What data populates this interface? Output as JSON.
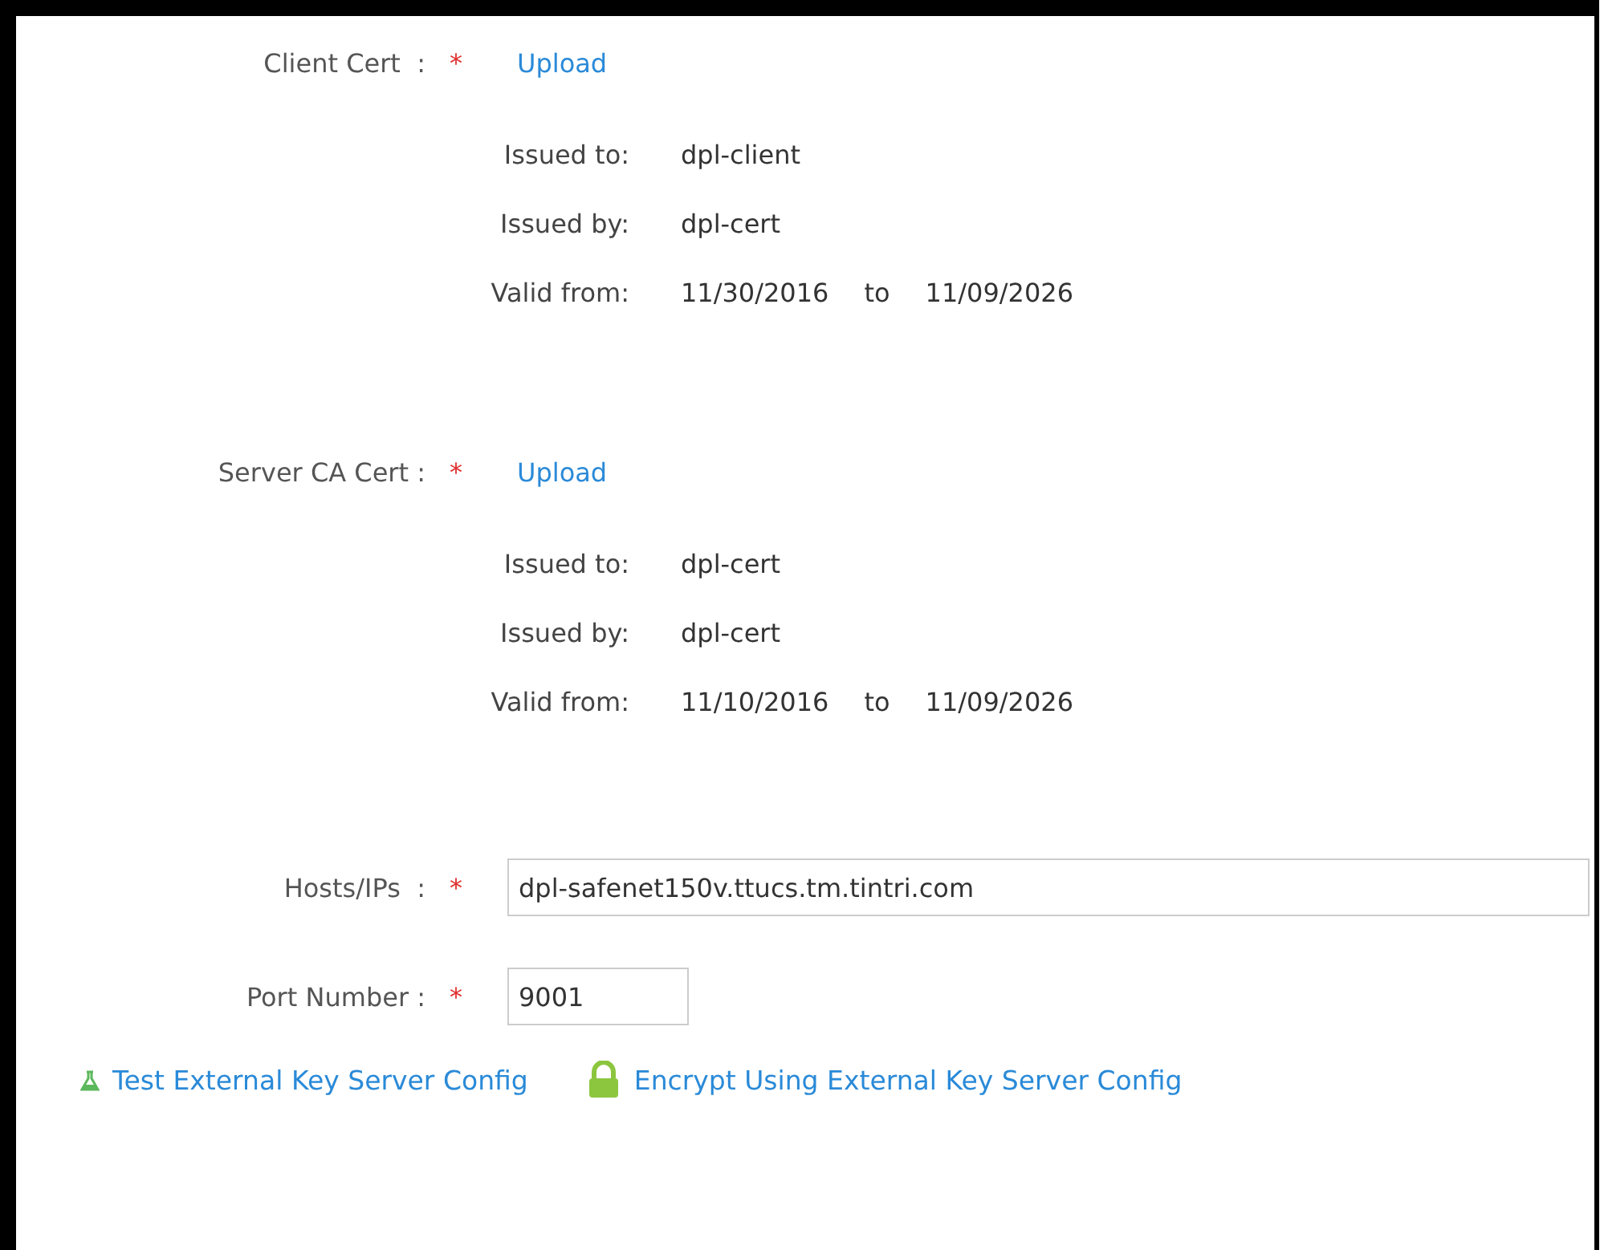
{
  "certificates": [
    {
      "label": "Client Cert  :",
      "required_mark": "*",
      "upload": "Upload",
      "details": [
        {
          "label": "Issued to:",
          "value": "dpl-client"
        },
        {
          "label": "Issued by:",
          "value": "dpl-cert"
        },
        {
          "label": "Valid from:",
          "value": "11/30/2016",
          "joiner": "to",
          "value_2": "11/09/2026"
        }
      ]
    },
    {
      "label": "Server CA Cert :",
      "required_mark": "*",
      "upload": "Upload",
      "details": [
        {
          "label": "Issued to:",
          "value": "dpl-cert"
        },
        {
          "label": "Issued by:",
          "value": "dpl-cert"
        },
        {
          "label": "Valid from:",
          "value": "11/10/2016",
          "joiner": "to",
          "value_2": "11/09/2026"
        }
      ]
    }
  ],
  "fields": [
    {
      "kind": "wide",
      "label": "Hosts/IPs  :",
      "required_mark": "*",
      "value": "dpl-safenet150v.ttucs.tm.tintri.com"
    },
    {
      "kind": "short",
      "label": "Port Number :",
      "required_mark": "*",
      "value": "9001"
    }
  ],
  "actions": [
    {
      "kind": "test",
      "label": "Test External Key Server Config"
    },
    {
      "kind": "encrypt",
      "label": "Encrypt Using External Key Server Config"
    }
  ]
}
